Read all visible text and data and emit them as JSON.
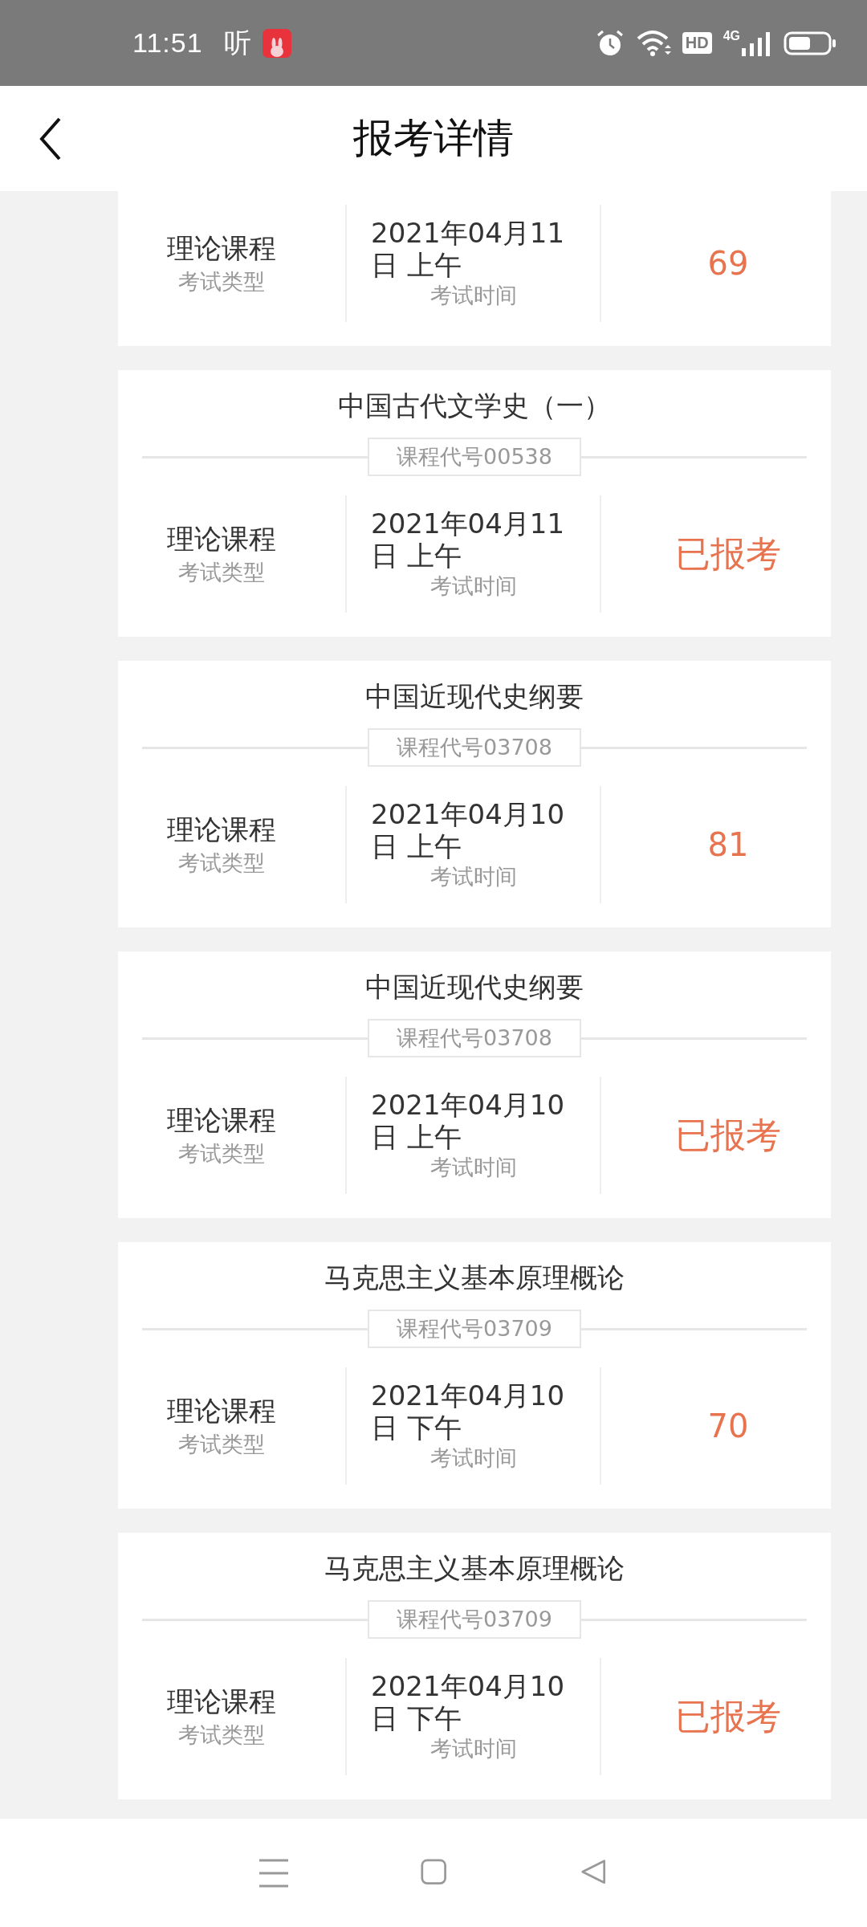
{
  "status_bar": {
    "time": "11:51",
    "app_glyph": "听",
    "network_badge": "HD",
    "network_type": "4G"
  },
  "header": {
    "title": "报考详情"
  },
  "exams": [
    {
      "type": "理论课程",
      "type_label": "考试类型",
      "date": "2021年04月11日 上午",
      "date_label": "考试时间",
      "result": "69",
      "kind": "score"
    },
    {
      "course": "中国古代文学史（一）",
      "code": "课程代号00538",
      "type": "理论课程",
      "type_label": "考试类型",
      "date": "2021年04月11日 上午",
      "date_label": "考试时间",
      "result": "已报考",
      "kind": "status"
    },
    {
      "course": "中国近现代史纲要",
      "code": "课程代号03708",
      "type": "理论课程",
      "type_label": "考试类型",
      "date": "2021年04月10日 上午",
      "date_label": "考试时间",
      "result": "81",
      "kind": "score"
    },
    {
      "course": "中国近现代史纲要",
      "code": "课程代号03708",
      "type": "理论课程",
      "type_label": "考试类型",
      "date": "2021年04月10日 上午",
      "date_label": "考试时间",
      "result": "已报考",
      "kind": "status"
    },
    {
      "course": "马克思主义基本原理概论",
      "code": "课程代号03709",
      "type": "理论课程",
      "type_label": "考试类型",
      "date": "2021年04月10日 下午",
      "date_label": "考试时间",
      "result": "70",
      "kind": "score"
    },
    {
      "course": "马克思主义基本原理概论",
      "code": "课程代号03709",
      "type": "理论课程",
      "type_label": "考试类型",
      "date": "2021年04月10日 下午",
      "date_label": "考试时间",
      "result": "已报考",
      "kind": "status"
    }
  ]
}
